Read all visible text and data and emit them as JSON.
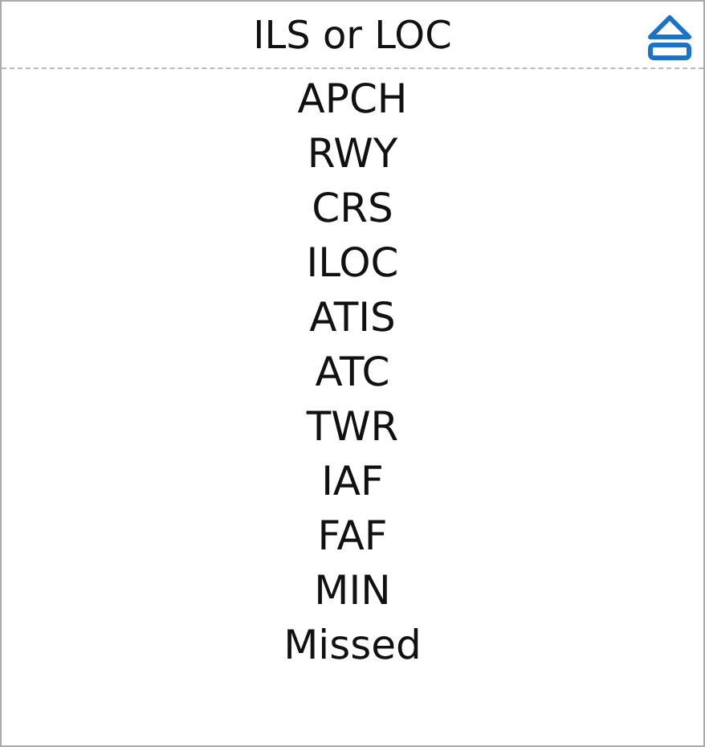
{
  "header": {
    "title": "ILS or LOC"
  },
  "items": [
    "APCH",
    "RWY",
    "CRS",
    "ILOC",
    "ATIS",
    "ATC",
    "TWR",
    "IAF",
    "FAF",
    "MIN",
    "Missed"
  ]
}
